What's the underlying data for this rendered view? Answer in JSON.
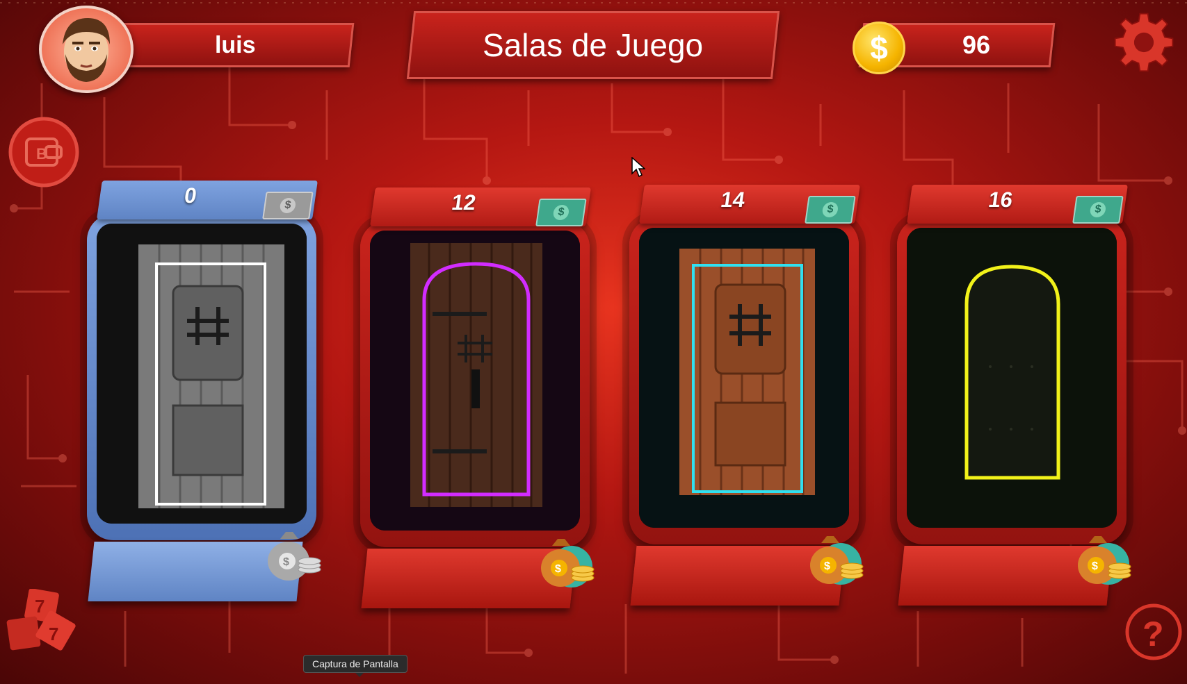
{
  "header": {
    "username": "luis",
    "title": "Salas de Juego",
    "coins": "96"
  },
  "rooms": [
    {
      "number": "0",
      "theme": "blue",
      "glow": "#ffffff",
      "selected": true
    },
    {
      "number": "12",
      "theme": "red",
      "glow": "#d22cff",
      "selected": false
    },
    {
      "number": "14",
      "theme": "red",
      "glow": "#30e0f0",
      "selected": false
    },
    {
      "number": "16",
      "theme": "red",
      "glow": "#f2f21a",
      "selected": false
    }
  ],
  "icons": {
    "avatar": "bearded-man-avatar",
    "coin": "dollar-coin-icon",
    "settings": "gear-icon",
    "wallet": "bitcoin-wallet-icon",
    "dice": "dice-icon",
    "help": "question-icon",
    "bill": "dollar-bill-icon",
    "reward": "money-bag-icon"
  },
  "colors": {
    "accent": "#c9231c",
    "selected": "#5f84c4",
    "background": "#b41712"
  },
  "tooltip": "Captura de Pantalla"
}
